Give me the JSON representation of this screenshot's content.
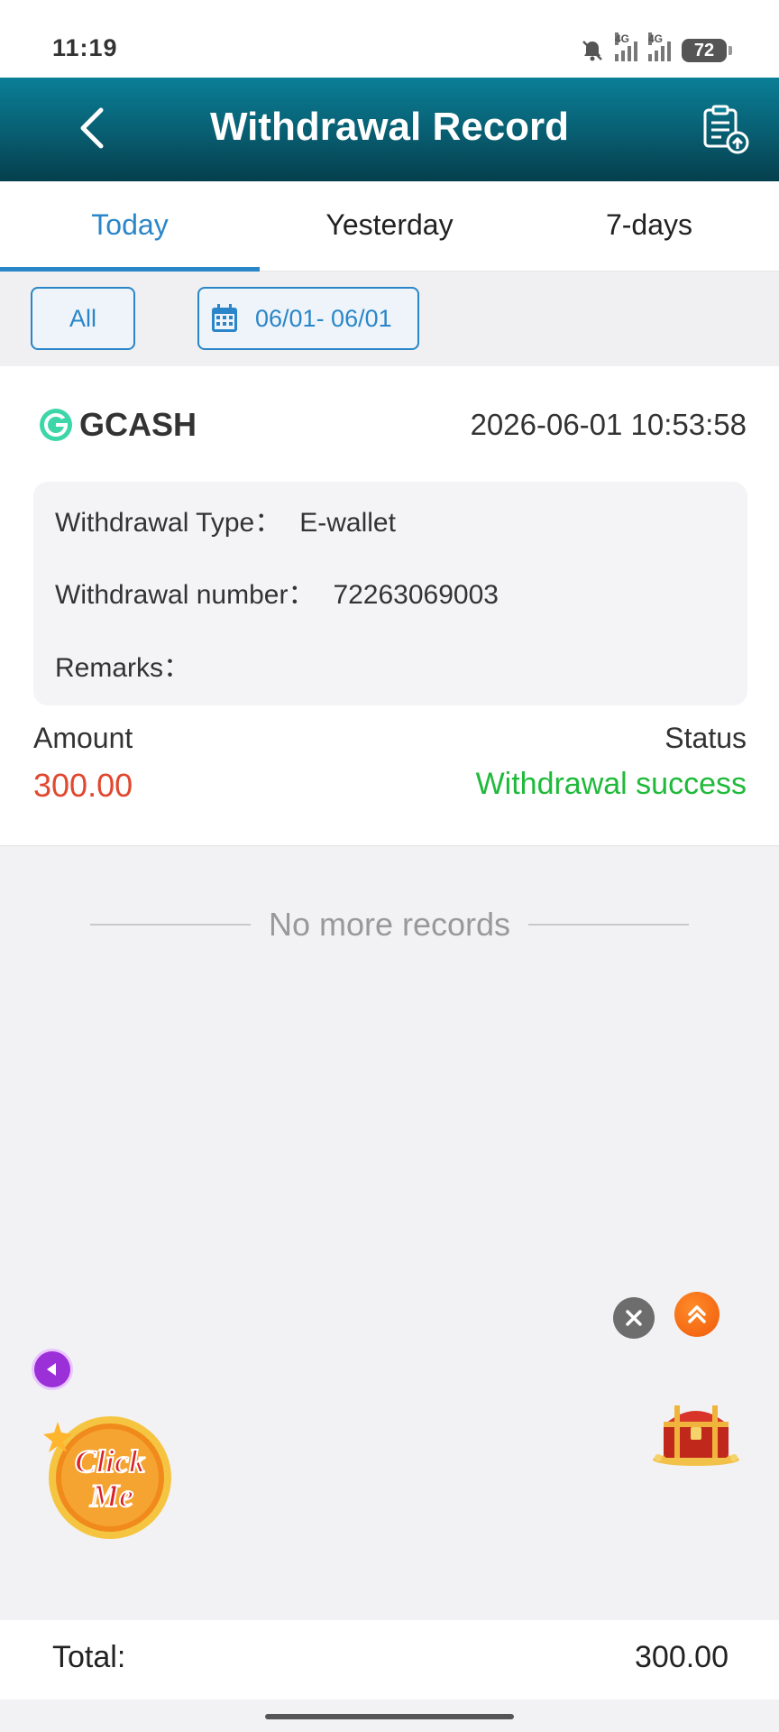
{
  "status_bar": {
    "time": "11:19",
    "network_1": "4G",
    "network_2": "4G",
    "battery": "72"
  },
  "header": {
    "title": "Withdrawal Record"
  },
  "tabs": [
    {
      "label": "Today",
      "active": true
    },
    {
      "label": "Yesterday",
      "active": false
    },
    {
      "label": "7-days",
      "active": false
    }
  ],
  "filters": {
    "all_label": "All",
    "date_range": "06/01- 06/01"
  },
  "record": {
    "method": "GCASH",
    "datetime": "2026-06-01 10:53:58",
    "type_label": "Withdrawal Type：",
    "type_value": "E-wallet",
    "number_label": "Withdrawal number：",
    "number_value": "72263069003",
    "remarks_label": "Remarks：",
    "remarks_value": "",
    "amount_label": "Amount",
    "amount_value": "300.00",
    "status_label": "Status",
    "status_value": "Withdrawal success"
  },
  "no_more_text": "No more records",
  "footer": {
    "total_label": "Total:",
    "total_value": "300.00"
  },
  "floating": {
    "click_me_line1": "Click",
    "click_me_line2": "Me"
  },
  "colors": {
    "accent": "#2a86c8",
    "header": "#085d70",
    "amount": "#e0482f",
    "success": "#1fba3a"
  },
  "icons": [
    "back-arrow-icon",
    "export-record-icon",
    "calendar-icon",
    "gcash-logo-icon",
    "close-icon",
    "scroll-top-icon",
    "collapse-arrow-icon",
    "treasure-chest-icon",
    "mute-bell-icon"
  ]
}
